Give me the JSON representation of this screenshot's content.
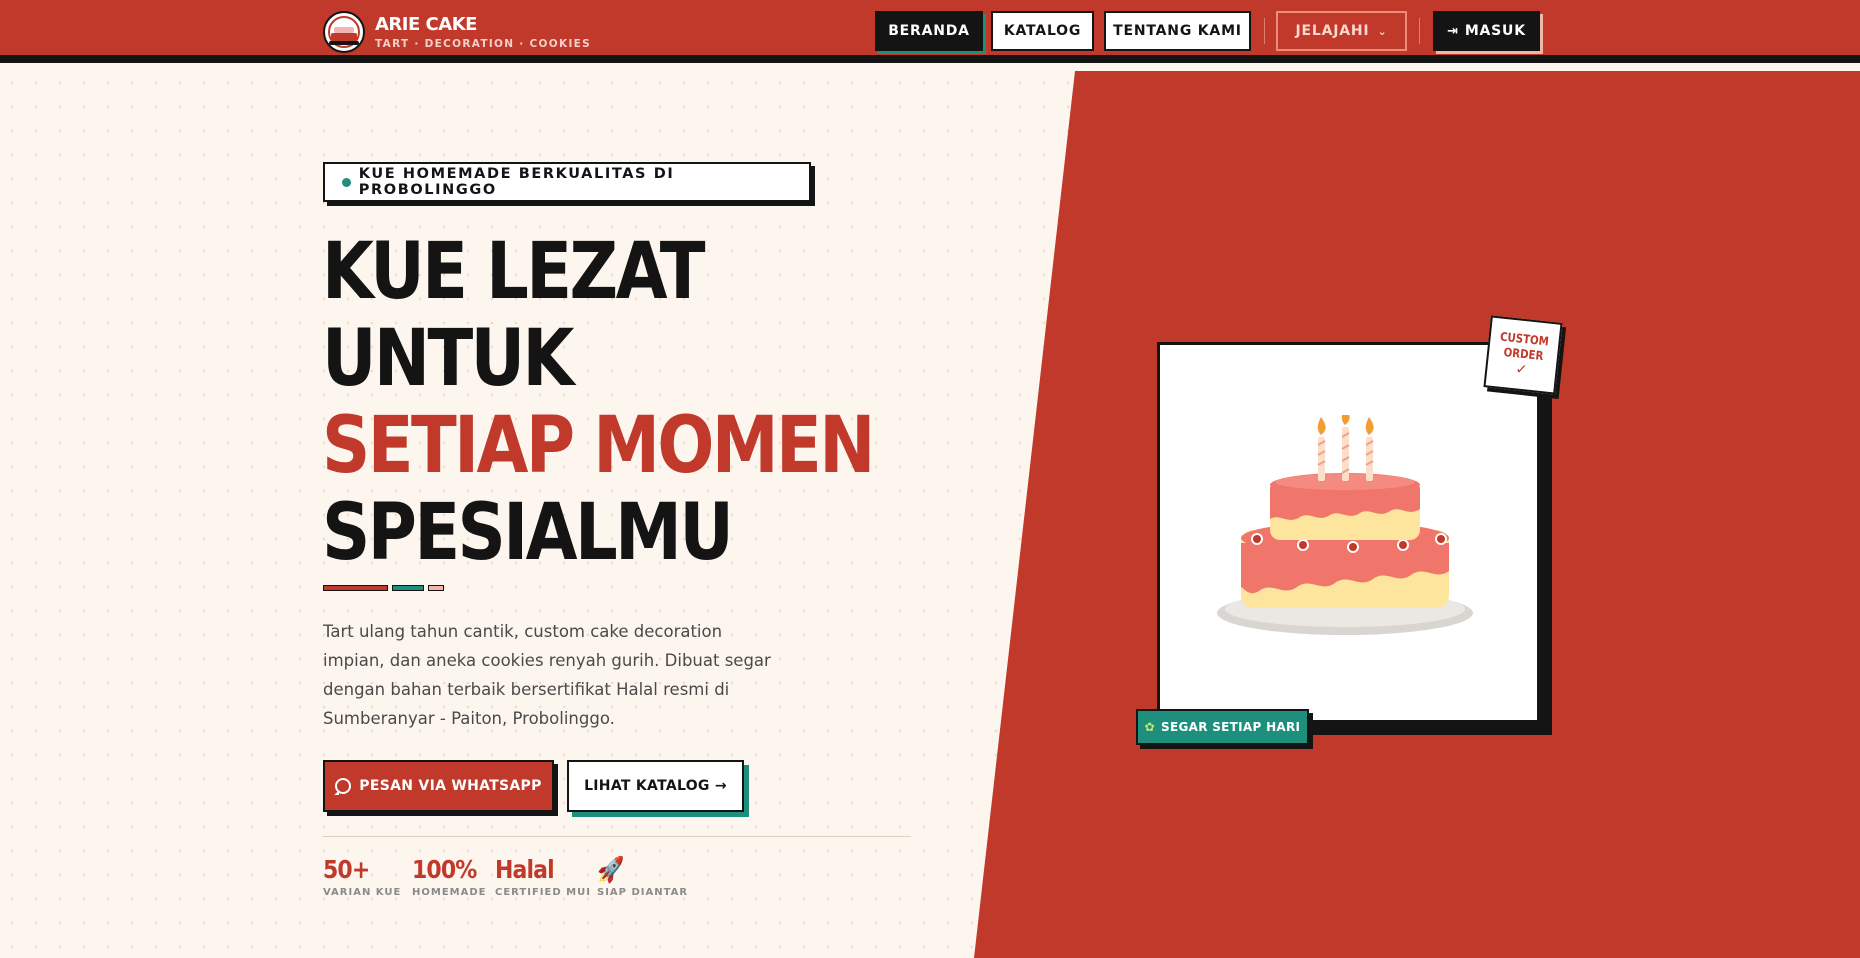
{
  "brand": {
    "name": "ARIE CAKE",
    "tagline": "TART · DECORATION · COOKIES",
    "logo_icon": "cake-logo-icon"
  },
  "nav": {
    "items": [
      {
        "label": "BERANDA",
        "active": true
      },
      {
        "label": "KATALOG",
        "active": false
      },
      {
        "label": "TENTANG KAMI",
        "active": false
      }
    ],
    "explore_label": "JELAJAHI",
    "login_label": "MASUK"
  },
  "hero": {
    "badge": "KUE HOMEMADE BERKUALITAS DI PROBOLINGGO",
    "headline": [
      "KUE LEZAT",
      "UNTUK",
      "SETIAP MOMEN",
      "SPESIALMU"
    ],
    "description": "Tart ulang tahun cantik, custom cake decoration impian, dan aneka cookies renyah gurih. Dibuat segar dengan bahan terbaik bersertifikat Halal resmi di Sumberanyar - Paiton, Probolinggo.",
    "cta_whatsapp": "PESAN VIA WHATSAPP",
    "cta_catalog": "LIHAT KATALOG →",
    "stats": [
      {
        "value": "50+",
        "label": "VARIAN KUE"
      },
      {
        "value": "100%",
        "label": "HOMEMADE"
      },
      {
        "value": "Halal",
        "label": "CERTIFIED MUI"
      },
      {
        "value": "🚀",
        "label": "SIAP DIANTAR"
      }
    ]
  },
  "card": {
    "sticker_line1": "CUSTOM",
    "sticker_line2": "ORDER",
    "sticker_check": "✓",
    "fresh_label": "SEGAR SETIAP HARI"
  },
  "colors": {
    "primary_red": "#c0392b",
    "teal": "#1f8f7d",
    "ink": "#141414",
    "cream": "#fdf6ee"
  }
}
